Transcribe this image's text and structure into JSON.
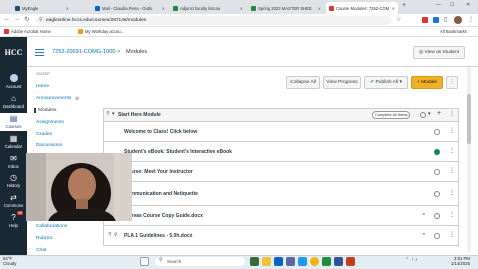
{
  "browser": {
    "tabs": [
      {
        "label": "MyEagle",
        "color": "#1a4f7d",
        "active": false
      },
      {
        "label": "Mail - Claudia.Pena - Outlo",
        "color": "#0a64c8",
        "active": false
      },
      {
        "label": "Adjunct faculty listcou",
        "color": "#1e8e3e",
        "active": false
      },
      {
        "label": "Spring 2023 MASTER SHEE",
        "color": "#1e8e3e",
        "active": false
      },
      {
        "label": "Course Modules: 7252-COM",
        "color": "#e8332b",
        "active": true
      }
    ],
    "new_tab": "+",
    "url": "eagleonline.hccs.edu/courses/287146/modules",
    "bookmarks": [
      {
        "label": "Adobe Acrobat Home",
        "color": "#e8332b"
      },
      {
        "label": "My Workday accou...",
        "color": "#f39c12"
      }
    ],
    "all_bookmarks": "All Bookmarks"
  },
  "global_nav": {
    "logo": "HCC",
    "items": [
      {
        "label": "Account",
        "icon": "avatar"
      },
      {
        "label": "Dashboard",
        "icon": "dashboard-icon"
      },
      {
        "label": "Courses",
        "icon": "book-icon",
        "active": true
      },
      {
        "label": "Calendar",
        "icon": "calendar-icon"
      },
      {
        "label": "Inbox",
        "icon": "inbox-icon"
      },
      {
        "label": "History",
        "icon": "clock-icon"
      },
      {
        "label": "Commons",
        "icon": "commons-icon"
      },
      {
        "label": "Help",
        "icon": "help-icon",
        "badge": "10"
      }
    ]
  },
  "header": {
    "course": "7252-20691-COMG-1000",
    "separator": ">",
    "page": "Modules",
    "view_as_student": "View as Student",
    "term": "2023SP"
  },
  "course_nav": {
    "items": [
      "Home",
      "Announcements",
      "Modules",
      "Assignments",
      "Grades",
      "Discussions"
    ],
    "lower_items": [
      "Collaborations",
      "Rubrics",
      "Chat"
    ]
  },
  "toolbar": {
    "collapse_all": "Collapse All",
    "view_progress": "View Progress",
    "publish_all": "Publish All",
    "add_module": "+ Module"
  },
  "module": {
    "title": "Start Here Module",
    "complete_badge": "Complete All Items",
    "items": [
      {
        "title": "Welcome to Class! Click below",
        "type": "header",
        "status": "unpublished"
      },
      {
        "title": "Student's eBook: Student's Interactive eBook",
        "type": "header",
        "status": "published"
      },
      {
        "title": "Course: Meet Your Instructor",
        "type": "header",
        "status": "unpublished"
      },
      {
        "title": "Communication and Netiquette",
        "type": "header",
        "status": "unpublished"
      },
      {
        "title": "Canvas Course Copy Guide.docx",
        "type": "file",
        "status": "partial"
      },
      {
        "title": "PLA 1 Guidelines - 5.0h.docx",
        "type": "file",
        "status": "partial"
      }
    ]
  },
  "taskbar": {
    "weather_temp": "54°F",
    "weather_desc": "Cloudy",
    "search": "Search",
    "time": "3:51 PM",
    "date": "1/14/2025"
  }
}
